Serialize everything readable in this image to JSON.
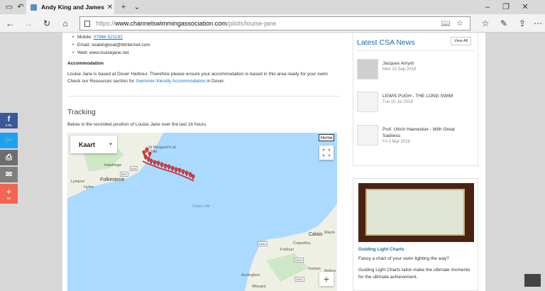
{
  "browser": {
    "tab_title": "Andy King and James K",
    "url_prefix": "https://",
    "url_domain": "www.channelswimmingassociation.com",
    "url_path": "/pilots/louise-jane"
  },
  "contact": {
    "mobile_label": "Mobile: ",
    "mobile_value": "07966 521192",
    "email": "Email: seakingboat@btinternet.com",
    "web": "Web: www.louisejane.net"
  },
  "accommodation": {
    "heading": "Accommodation",
    "line1": "Louise Jane is based at Dover Harbour. Therefore please ensure your accommodation is based in this area ready for your swim",
    "line2_pre": "Check our Resources section for ",
    "line2_link": "Swimmer-friendly Accommodation",
    "line2_post": " in Dover."
  },
  "tracking": {
    "heading": "Tracking",
    "description": "Below is the recorded position of Louise Jane over the last 16 hours."
  },
  "map": {
    "map_type": "Kaart",
    "home_label": "Home",
    "zoom_in": "+",
    "labels": {
      "st_margarets": "St Margaret's at Cliffe",
      "hawkinge": "Hawkinge",
      "folkestone": "Folkestone",
      "lympne": "Lympne",
      "hythe": "Hythe",
      "calais_vile": "Calais vile",
      "calais": "Calais",
      "marck": "Marck",
      "coquelles": "Coquelles",
      "frethun": "Fréthun",
      "guines": "Guînes",
      "ardres": "Ardres",
      "audinghen": "Audinghen",
      "wissant": "Wissant"
    },
    "roads": {
      "m20": "M20",
      "a20": "A20",
      "d940": "D940",
      "d243": "D243",
      "d231": "D231"
    }
  },
  "news": {
    "heading": "Latest CSA News",
    "view_all": "View All",
    "items": [
      {
        "title": "Jacques Amyot",
        "date": "Mon 10 Sep 2018"
      },
      {
        "title": "LEWIS PUGH - THE LONG SWIM",
        "date": "Tue 10 Jul 2018"
      },
      {
        "title": "Prof. Ulrich Haevecker - With Great Sadness",
        "date": "Fri 2 Mar 2018"
      }
    ]
  },
  "promo": {
    "title": "Guiding Light Charts",
    "line1": "Fancy a chart of your swim lighting the way?",
    "line2": "Guiding Light Charts tailor-make the ultimate momento for the ultimate achievement."
  },
  "share": {
    "facebook_count": "6.9K",
    "plus_count": "60"
  },
  "colors": {
    "facebook": "#3b5998",
    "twitter": "#1da1f2",
    "print": "#6d6d6d",
    "email": "#7f7f7f",
    "plus": "#f26552",
    "link": "#1a73c8"
  }
}
